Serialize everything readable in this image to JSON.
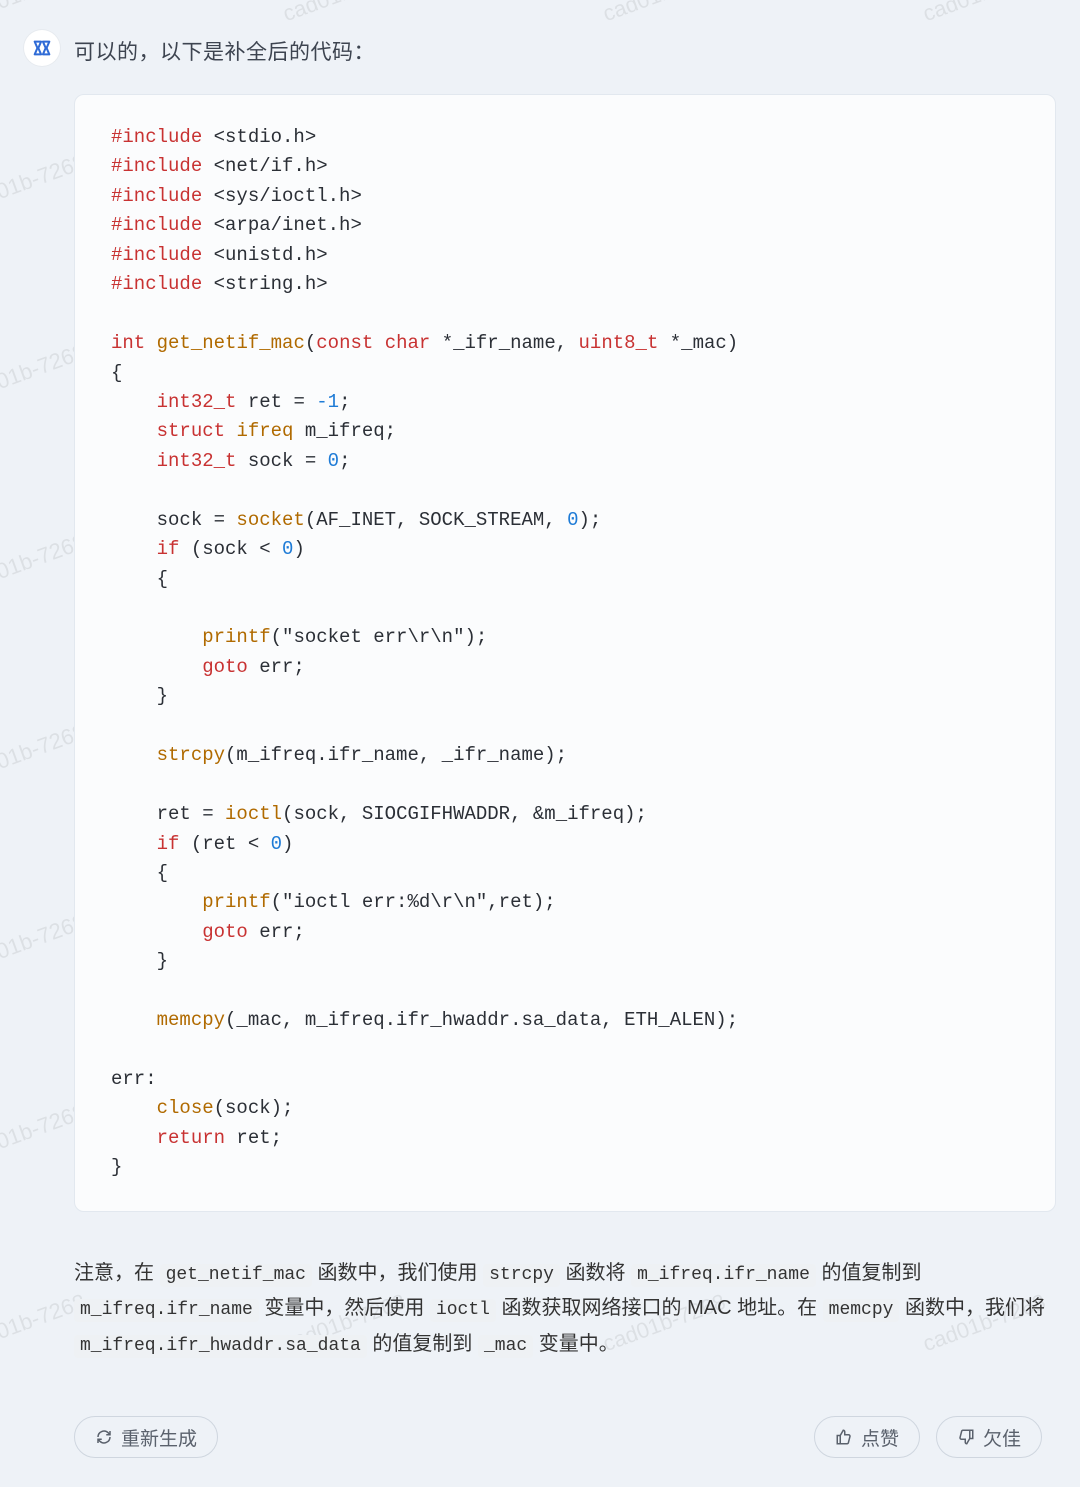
{
  "watermark": "cad01b-7268",
  "message": {
    "intro": "可以的，以下是补全后的代码：",
    "code_lines": [
      [
        [
          "pre",
          "#include"
        ],
        [
          "plain",
          " <stdio.h>"
        ]
      ],
      [
        [
          "pre",
          "#include"
        ],
        [
          "plain",
          " <net/if.h>"
        ]
      ],
      [
        [
          "pre",
          "#include"
        ],
        [
          "plain",
          " <sys/ioctl.h>"
        ]
      ],
      [
        [
          "pre",
          "#include"
        ],
        [
          "plain",
          " <arpa/inet.h>"
        ]
      ],
      [
        [
          "pre",
          "#include"
        ],
        [
          "plain",
          " <unistd.h>"
        ]
      ],
      [
        [
          "pre",
          "#include"
        ],
        [
          "plain",
          " <string.h>"
        ]
      ],
      [],
      [
        [
          "kw",
          "int"
        ],
        [
          "plain",
          " "
        ],
        [
          "func",
          "get_netif_mac"
        ],
        [
          "plain",
          "("
        ],
        [
          "kw",
          "const"
        ],
        [
          "plain",
          " "
        ],
        [
          "kw",
          "char"
        ],
        [
          "plain",
          " *_ifr_name, "
        ],
        [
          "type",
          "uint8_t"
        ],
        [
          "plain",
          " *_mac)"
        ]
      ],
      [
        [
          "plain",
          "{"
        ]
      ],
      [
        [
          "plain",
          "    "
        ],
        [
          "type",
          "int32_t"
        ],
        [
          "plain",
          " ret = "
        ],
        [
          "num",
          "-1"
        ],
        [
          "plain",
          ";"
        ]
      ],
      [
        [
          "plain",
          "    "
        ],
        [
          "kw",
          "struct"
        ],
        [
          "plain",
          " "
        ],
        [
          "struct",
          "ifreq"
        ],
        [
          "plain",
          " m_ifreq;"
        ]
      ],
      [
        [
          "plain",
          "    "
        ],
        [
          "type",
          "int32_t"
        ],
        [
          "plain",
          " sock = "
        ],
        [
          "num",
          "0"
        ],
        [
          "plain",
          ";"
        ]
      ],
      [],
      [
        [
          "plain",
          "    sock = "
        ],
        [
          "func",
          "socket"
        ],
        [
          "plain",
          "(AF_INET, SOCK_STREAM, "
        ],
        [
          "num",
          "0"
        ],
        [
          "plain",
          ");"
        ]
      ],
      [
        [
          "plain",
          "    "
        ],
        [
          "kw",
          "if"
        ],
        [
          "plain",
          " (sock < "
        ],
        [
          "num",
          "0"
        ],
        [
          "plain",
          ")"
        ]
      ],
      [
        [
          "plain",
          "    {"
        ]
      ],
      [],
      [
        [
          "plain",
          "        "
        ],
        [
          "func",
          "printf"
        ],
        [
          "plain",
          "(\"socket err\\r\\n\");"
        ]
      ],
      [
        [
          "plain",
          "        "
        ],
        [
          "kw",
          "goto"
        ],
        [
          "plain",
          " err;"
        ]
      ],
      [
        [
          "plain",
          "    }"
        ]
      ],
      [],
      [
        [
          "plain",
          "    "
        ],
        [
          "func",
          "strcpy"
        ],
        [
          "plain",
          "(m_ifreq.ifr_name, _ifr_name);"
        ]
      ],
      [],
      [
        [
          "plain",
          "    ret = "
        ],
        [
          "func",
          "ioctl"
        ],
        [
          "plain",
          "(sock, SIOCGIFHWADDR, &m_ifreq);"
        ]
      ],
      [
        [
          "plain",
          "    "
        ],
        [
          "kw",
          "if"
        ],
        [
          "plain",
          " (ret < "
        ],
        [
          "num",
          "0"
        ],
        [
          "plain",
          ")"
        ]
      ],
      [
        [
          "plain",
          "    {"
        ]
      ],
      [
        [
          "plain",
          "        "
        ],
        [
          "func",
          "printf"
        ],
        [
          "plain",
          "(\"ioctl err:%d\\r\\n\",ret);"
        ]
      ],
      [
        [
          "plain",
          "        "
        ],
        [
          "kw",
          "goto"
        ],
        [
          "plain",
          " err;"
        ]
      ],
      [
        [
          "plain",
          "    }"
        ]
      ],
      [],
      [
        [
          "plain",
          "    "
        ],
        [
          "func",
          "memcpy"
        ],
        [
          "plain",
          "(_mac, m_ifreq.ifr_hwaddr.sa_data, ETH_ALEN);"
        ]
      ],
      [],
      [
        [
          "plain",
          "err:"
        ]
      ],
      [
        [
          "plain",
          "    "
        ],
        [
          "func",
          "close"
        ],
        [
          "plain",
          "(sock);"
        ]
      ],
      [
        [
          "plain",
          "    "
        ],
        [
          "kw",
          "return"
        ],
        [
          "plain",
          " ret;"
        ]
      ],
      [
        [
          "plain",
          "}"
        ]
      ]
    ],
    "explain_parts": [
      [
        "text",
        "注意，在 "
      ],
      [
        "code",
        "get_netif_mac"
      ],
      [
        "text",
        " 函数中，我们使用 "
      ],
      [
        "code",
        "strcpy"
      ],
      [
        "text",
        " 函数将 "
      ],
      [
        "code",
        "m_ifreq.ifr_name"
      ],
      [
        "text",
        " 的值复制到 "
      ],
      [
        "code",
        "m_ifreq.ifr_name"
      ],
      [
        "text",
        " 变量中，然后使用 "
      ],
      [
        "code",
        "ioctl"
      ],
      [
        "text",
        " 函数获取网络接口的 MAC 地址。在 "
      ],
      [
        "code",
        "memcpy"
      ],
      [
        "text",
        " 函数中，我们将 "
      ],
      [
        "code",
        "m_ifreq.ifr_hwaddr.sa_data"
      ],
      [
        "text",
        " 的值复制到 "
      ],
      [
        "code",
        "_mac"
      ],
      [
        "text",
        " 变量中。"
      ]
    ]
  },
  "actions": {
    "regenerate": "重新生成",
    "like": "点赞",
    "dislike": "欠佳"
  }
}
